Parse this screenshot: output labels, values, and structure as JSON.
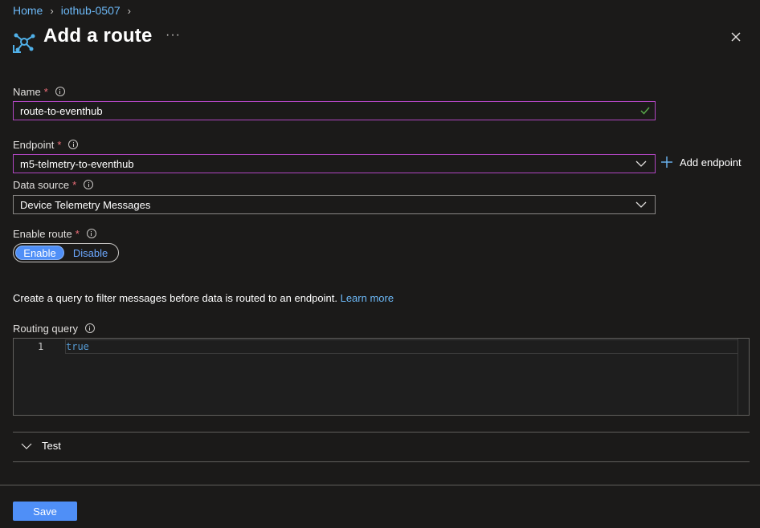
{
  "breadcrumb": {
    "home": "Home",
    "hub": "iothub-0507"
  },
  "header": {
    "title": "Add a route",
    "more": "···"
  },
  "form": {
    "name": {
      "label": "Name",
      "value": "route-to-eventhub"
    },
    "endpoint": {
      "label": "Endpoint",
      "value": "m5-telmetry-to-eventhub",
      "add_label": "Add endpoint"
    },
    "data_source": {
      "label": "Data source",
      "value": "Device Telemetry Messages"
    },
    "enable_route": {
      "label": "Enable route",
      "on": "Enable",
      "off": "Disable",
      "selected": "Enable"
    },
    "required_mark": "*"
  },
  "query": {
    "description": "Create a query to filter messages before data is routed to an endpoint.",
    "learn_more": "Learn more",
    "label": "Routing query",
    "line_number": "1",
    "code": "true"
  },
  "test": {
    "label": "Test"
  },
  "footer": {
    "save": "Save"
  },
  "colors": {
    "accent": "#4f8ff7",
    "link": "#6cb8f6",
    "required": "#f1707b",
    "focus_border": "#b146c2",
    "background": "#1b1a19"
  },
  "icons": [
    "route-icon",
    "more-icon",
    "close-icon",
    "info-icon",
    "check-icon",
    "chevron-down-icon",
    "plus-icon"
  ]
}
